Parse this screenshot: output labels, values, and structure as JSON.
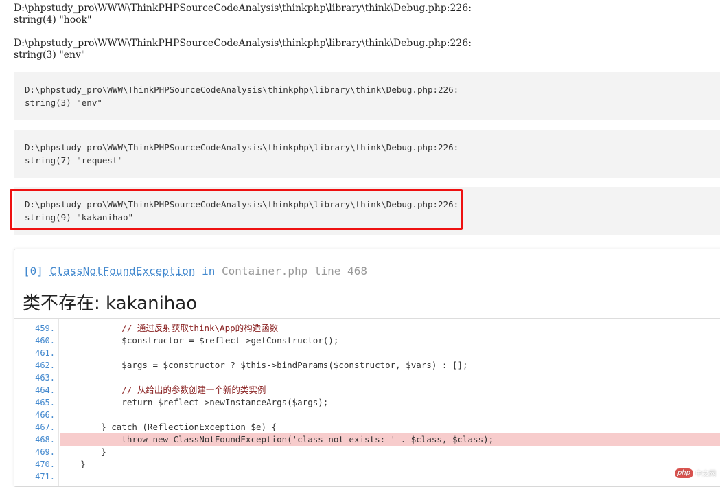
{
  "raw_dumps": [
    {
      "path": "D:\\phpstudy_pro\\WWW\\ThinkPHPSourceCodeAnalysis\\thinkphp\\library\\think\\Debug.php:226:",
      "value": "string(4) \"hook\""
    },
    {
      "path": "D:\\phpstudy_pro\\WWW\\ThinkPHPSourceCodeAnalysis\\thinkphp\\library\\think\\Debug.php:226:",
      "value": "string(3) \"env\""
    }
  ],
  "boxed_dumps": [
    {
      "path": "D:\\phpstudy_pro\\WWW\\ThinkPHPSourceCodeAnalysis\\thinkphp\\library\\think\\Debug.php:226:",
      "value": "string(3) \"env\""
    },
    {
      "path": "D:\\phpstudy_pro\\WWW\\ThinkPHPSourceCodeAnalysis\\thinkphp\\library\\think\\Debug.php:226:",
      "value": "string(7) \"request\""
    },
    {
      "path": "D:\\phpstudy_pro\\WWW\\ThinkPHPSourceCodeAnalysis\\thinkphp\\library\\think\\Debug.php:226:",
      "value": "string(9) \"kakanihao\""
    }
  ],
  "exception": {
    "index": "[0]",
    "class_name": "ClassNotFoundException",
    "in_word": "in",
    "file": "Container.php",
    "line_label": "line 468",
    "message": "类不存在: kakanihao"
  },
  "source": {
    "error_line": "468.",
    "lines": [
      {
        "no": "459.",
        "text": "            // 通过反射获取think\\App的构造函数",
        "kind": "comment"
      },
      {
        "no": "460.",
        "text": "            $constructor = $reflect->getConstructor();",
        "kind": "code"
      },
      {
        "no": "461.",
        "text": "",
        "kind": "code"
      },
      {
        "no": "462.",
        "text": "            $args = $constructor ? $this->bindParams($constructor, $vars) : [];",
        "kind": "code"
      },
      {
        "no": "463.",
        "text": "",
        "kind": "code"
      },
      {
        "no": "464.",
        "text": "            // 从给出的参数创建一个新的类实例",
        "kind": "comment"
      },
      {
        "no": "465.",
        "text": "            return $reflect->newInstanceArgs($args);",
        "kind": "code"
      },
      {
        "no": "466.",
        "text": "",
        "kind": "code"
      },
      {
        "no": "467.",
        "text": "        } catch (ReflectionException $e) {",
        "kind": "code"
      },
      {
        "no": "468.",
        "text": "            throw new ClassNotFoundException('class not exists: ' . $class, $class);",
        "kind": "code"
      },
      {
        "no": "469.",
        "text": "        }",
        "kind": "code"
      },
      {
        "no": "470.",
        "text": "    }",
        "kind": "code"
      },
      {
        "no": "471.",
        "text": "",
        "kind": "code"
      }
    ]
  },
  "watermark": {
    "logo": "php",
    "text": "中文网"
  },
  "colors": {
    "highlight_frame": "#ee1111",
    "error_line_bg": "#f7cccc",
    "accent": "#4288ce"
  }
}
